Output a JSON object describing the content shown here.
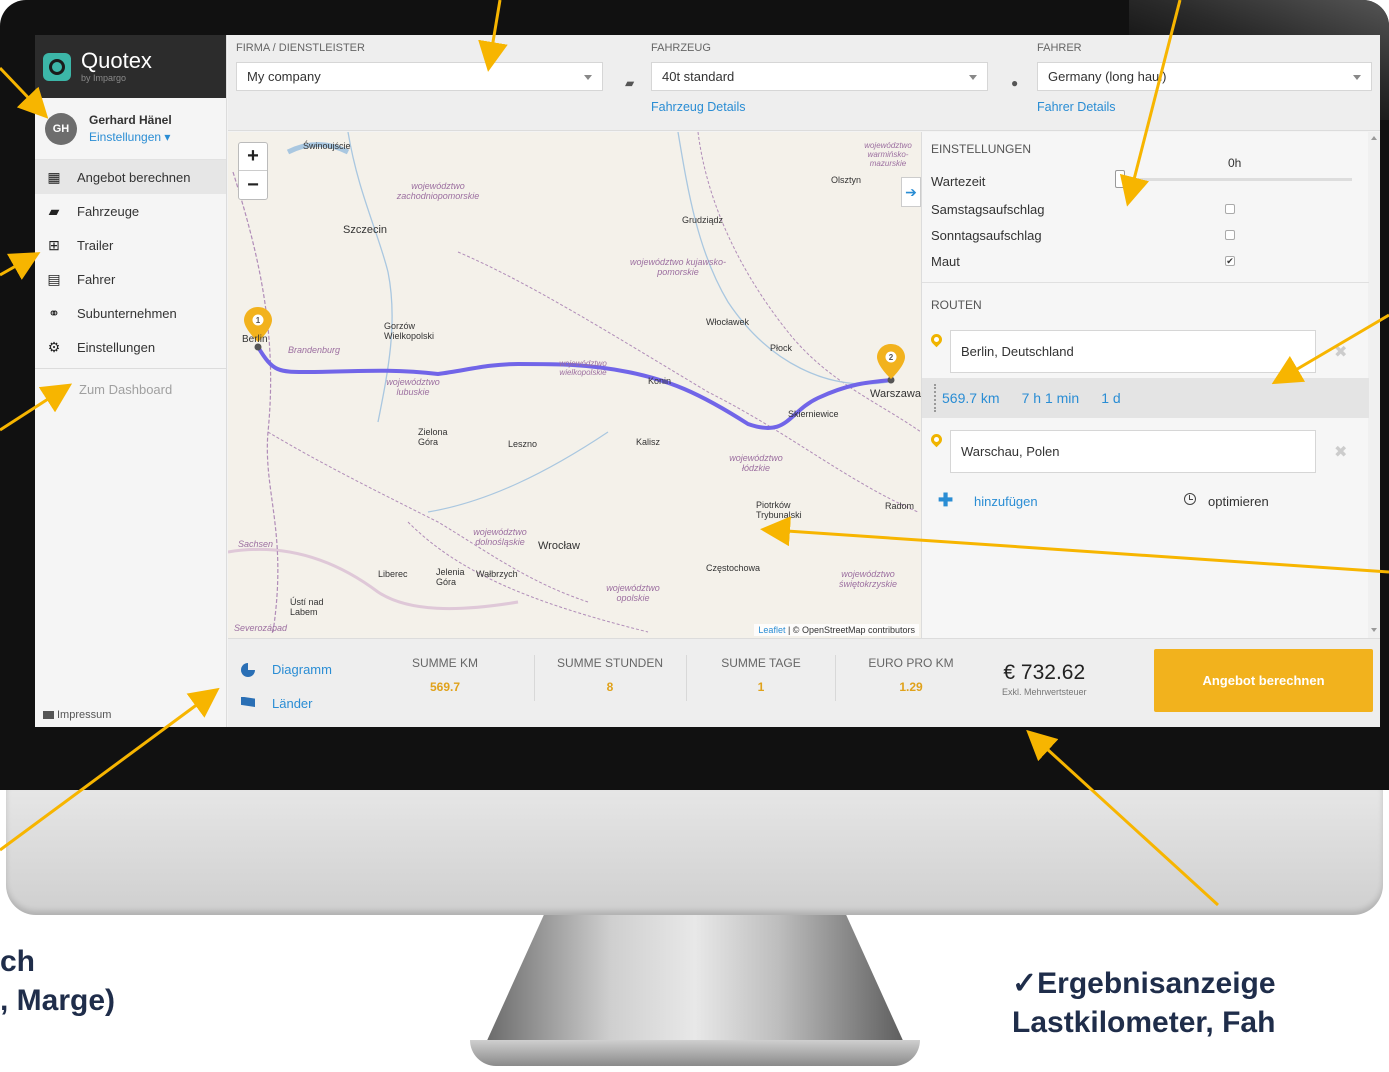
{
  "brand": {
    "name": "Quotex",
    "sub": "by Impargo"
  },
  "user": {
    "initials": "GH",
    "name": "Gerhard Hänel",
    "settings": "Einstellungen ▾"
  },
  "nav": {
    "items": [
      {
        "label": "Angebot berechnen",
        "icon": "calculator-icon"
      },
      {
        "label": "Fahrzeuge",
        "icon": "truck-icon"
      },
      {
        "label": "Trailer",
        "icon": "plus-square-icon"
      },
      {
        "label": "Fahrer",
        "icon": "id-card-icon"
      },
      {
        "label": "Subunternehmen",
        "icon": "handshake-icon"
      },
      {
        "label": "Einstellungen",
        "icon": "gears-icon"
      }
    ],
    "dashboard": "Zum Dashboard",
    "impressum": "Impressum"
  },
  "topbar": {
    "company_label": "FIRMA / DIENSTLEISTER",
    "company_value": "My company",
    "vehicle_label": "FAHRZEUG",
    "vehicle_value": "40t standard",
    "vehicle_link": "Fahrzeug Details",
    "driver_label": "FAHRER",
    "driver_value": "Germany (long haul)",
    "driver_link": "Fahrer Details"
  },
  "map": {
    "zoom_in": "+",
    "zoom_out": "−",
    "attribution_leaflet": "Leaflet",
    "attribution_rest": "| © OpenStreetMap contributors",
    "marker_start": "1",
    "marker_end": "2",
    "cities": [
      "Świnoujście",
      "Szczecin",
      "Gorzów Wielkopolski",
      "Berlin",
      "Brandenburg",
      "Zielona Góra",
      "Leszno",
      "Kalisz",
      "Konin",
      "Włocławek",
      "Płock",
      "Grudziądz",
      "Olsztyn",
      "Warszawa",
      "Skierniewice",
      "Radom",
      "Piotrków Trybunalski",
      "Częstochowa",
      "Wrocław",
      "Wałbrzych",
      "Jelenia Góra",
      "Liberec",
      "Ústí nad Labem",
      "Sachsen",
      "Severozápad"
    ],
    "regions": [
      "województwo zachodniopomorskie",
      "województwo kujawsko-pomorskie",
      "województwo wielkopolskie",
      "województwo lubuskie",
      "województwo łódzkie",
      "województwo dolnośląskie",
      "województwo opolskie",
      "województwo świętokrzyskie",
      "województwo warmińsko-mazurskie"
    ]
  },
  "panel": {
    "settings_title": "EINSTELLUNGEN",
    "wait_label": "Wartezeit",
    "wait_value": "0h",
    "saturday_label": "Samstagsaufschlag",
    "saturday_checked": false,
    "sunday_label": "Sonntagsaufschlag",
    "sunday_checked": false,
    "toll_label": "Maut",
    "toll_checked": true,
    "routes_title": "ROUTEN",
    "route_from": "Berlin, Deutschland",
    "route_to": "Warschau, Polen",
    "route_km": "569.7 km",
    "route_time": "7 h 1 min",
    "route_days": "1 d",
    "add_label": "hinzufügen",
    "optimize_label": "optimieren"
  },
  "summary": {
    "diagram_label": "Diagramm",
    "countries_label": "Länder",
    "stats": [
      {
        "label": "SUMME KM",
        "value": "569.7"
      },
      {
        "label": "SUMME STUNDEN",
        "value": "8"
      },
      {
        "label": "SUMME TAGE",
        "value": "1"
      },
      {
        "label": "EURO PRO KM",
        "value": "1.29"
      }
    ],
    "total": "€ 732.62",
    "total_note": "Exkl. Mehrwertsteuer",
    "button": "Angebot berechnen"
  },
  "captions": {
    "left_line1": "ch",
    "left_line2": ", Marge)",
    "right_line1": "✓Ergebnisanzeige",
    "right_line2": "Lastkilometer, Fah"
  },
  "colors": {
    "accent": "#f2b21d",
    "link": "#2a8dd4",
    "route": "#7165e8",
    "arrow": "#f7b500"
  }
}
